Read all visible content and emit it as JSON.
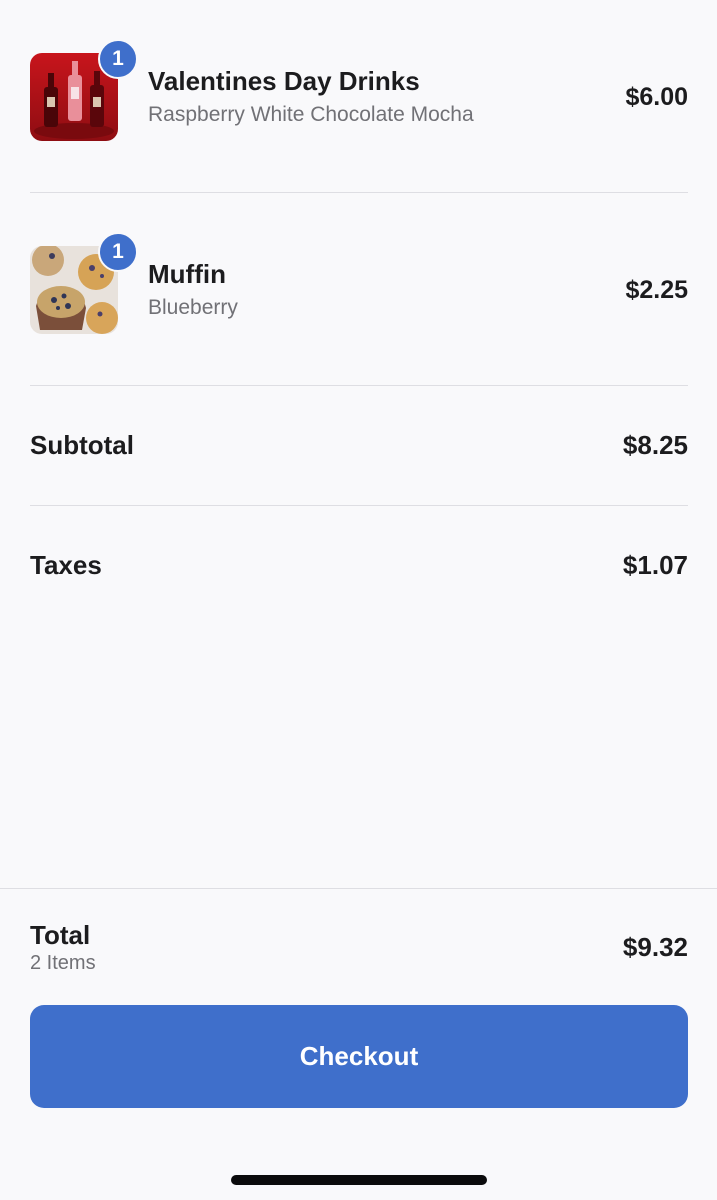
{
  "cart": {
    "items": [
      {
        "name": "Valentines Day Drinks",
        "variant": "Raspberry White Chocolate Mocha",
        "price": "$6.00",
        "quantity": "1",
        "image": "red-syrup-bottles-photo"
      },
      {
        "name": "Muffin",
        "variant": "Blueberry",
        "price": "$2.25",
        "quantity": "1",
        "image": "blueberry-muffins-photo"
      }
    ]
  },
  "summary": {
    "subtotal_label": "Subtotal",
    "subtotal_value": "$8.25",
    "taxes_label": "Taxes",
    "taxes_value": "$1.07"
  },
  "footer": {
    "total_label": "Total",
    "items_count": "2 Items",
    "total_value": "$9.32",
    "checkout_label": "Checkout"
  },
  "colors": {
    "accent": "#3f6fcb",
    "background": "#f9f9fb",
    "secondary_text": "#717176",
    "divider": "#dedee3"
  }
}
